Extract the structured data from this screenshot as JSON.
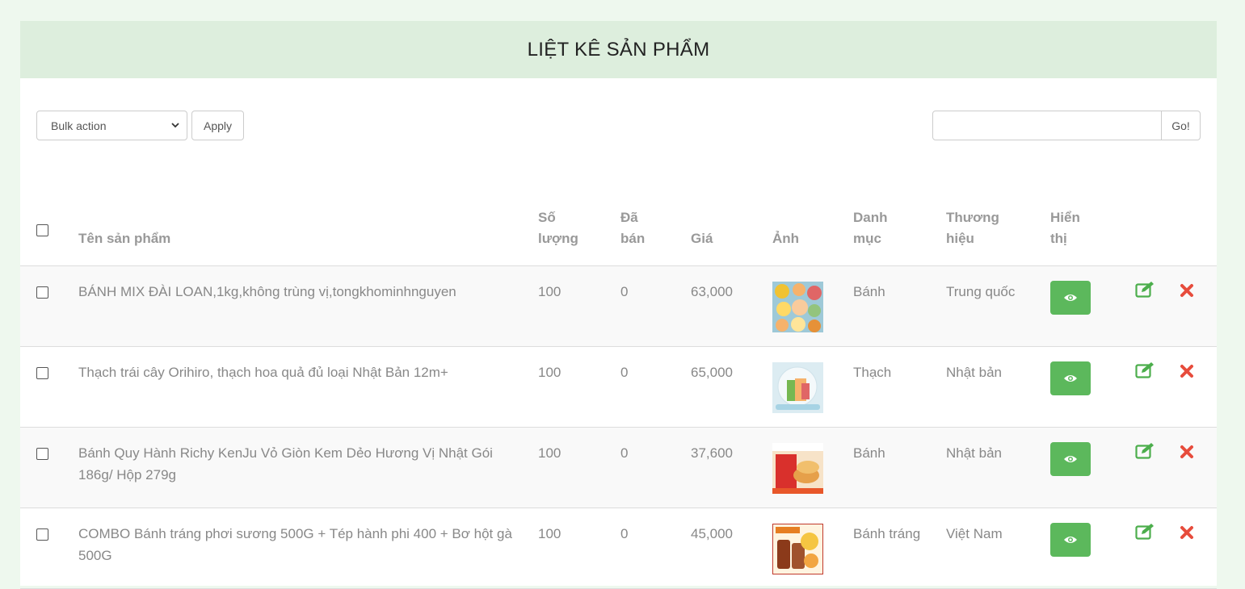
{
  "page": {
    "title": "LIỆT KÊ SẢN PHẨM"
  },
  "toolbar": {
    "bulk_action": "Bulk action",
    "apply_label": "Apply",
    "search_value": "",
    "go_label": "Go!"
  },
  "table": {
    "headers": {
      "name": "Tên sản phẩm",
      "quantity_1": "Số",
      "quantity_2": "lượng",
      "sold_1": "Đã",
      "sold_2": "bán",
      "price": "Giá",
      "image": "Ảnh",
      "category_1": "Danh",
      "category_2": "mục",
      "brand_1": "Thương",
      "brand_2": "hiệu",
      "visible_1": "Hiển",
      "visible_2": "thị"
    },
    "rows": [
      {
        "name": "BÁNH MIX ĐÀI LOAN,1kg,không trùng vị,tongkhominhnguyen",
        "quantity": "100",
        "sold": "0",
        "price": "63,000",
        "category": "Bánh",
        "brand": "Trung quốc"
      },
      {
        "name": "Thạch trái cây Orihiro, thạch hoa quả đủ loại Nhật Bản 12m+",
        "quantity": "100",
        "sold": "0",
        "price": "65,000",
        "category": "Thạch",
        "brand": "Nhật bản"
      },
      {
        "name": "Bánh Quy Hành Richy KenJu Vỏ Giòn Kem Dẻo Hương Vị Nhật Gói 186g/ Hộp 279g",
        "quantity": "100",
        "sold": "0",
        "price": "37,600",
        "category": "Bánh",
        "brand": "Nhật bản"
      },
      {
        "name": "COMBO Bánh tráng phơi sương 500G + Tép hành phi 400 + Bơ hột gà 500G",
        "quantity": "100",
        "sold": "0",
        "price": "45,000",
        "category": "Bánh tráng",
        "brand": "Việt Nam"
      }
    ]
  },
  "colors": {
    "header_bg": "#ddeedd",
    "eye_button": "#5cb85c",
    "edit_icon": "#4cae4c",
    "delete_icon": "#e74c3c"
  },
  "icons": {
    "visible": "eye-icon",
    "edit": "edit-icon",
    "delete": "delete-icon",
    "select": "chevron-down-icon"
  }
}
